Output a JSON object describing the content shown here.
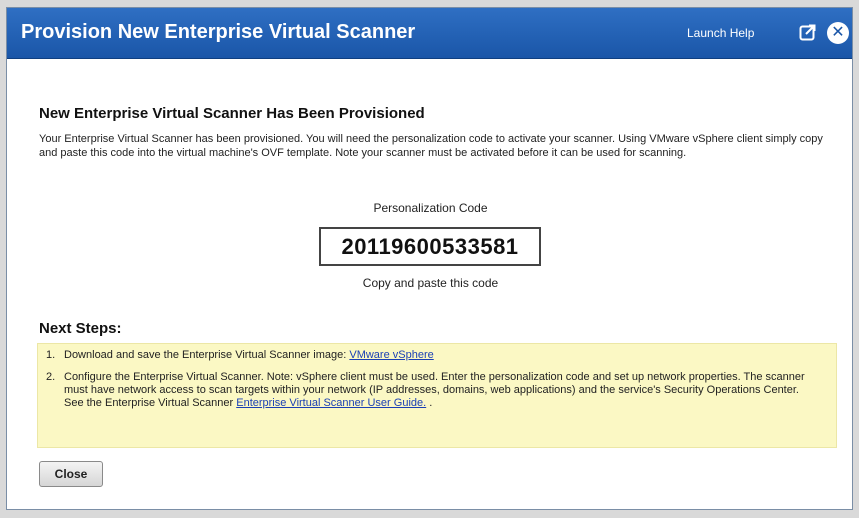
{
  "window": {
    "title": "Provision New Enterprise Virtual Scanner",
    "launch_help": "Launch Help",
    "close_glyph": "✕",
    "icons": {
      "popout": "popout-icon",
      "close": "close-icon"
    },
    "colors": {
      "titlebar": "#1f5db0",
      "steps_bg": "#fbf8c4",
      "link": "#1a3fb5"
    }
  },
  "main": {
    "heading": "New Enterprise Virtual Scanner Has Been Provisioned",
    "intro": "Your Enterprise Virtual Scanner has been provisioned. You will need the personalization code to activate your scanner. Using VMware vSphere client simply copy and paste this code into the virtual machine's OVF template. Note your scanner must be activated before it can be used for scanning.",
    "code_label": "Personalization Code",
    "code": "20119600533581",
    "code_hint": "Copy and paste this code"
  },
  "next_steps": {
    "title": "Next Steps:",
    "step1": {
      "num": "1.",
      "text": "Download and save the Enterprise Virtual Scanner image: ",
      "link": "VMware vSphere"
    },
    "step2": {
      "num": "2.",
      "text": "Configure the Enterprise Virtual Scanner. Note: vSphere client must be used. Enter the personalization code and set up network properties. The scanner must have network access to scan targets within your network (IP addresses, domains, web applications) and the service's Security Operations Center. See the Enterprise Virtual Scanner ",
      "link": "Enterprise Virtual Scanner User Guide.",
      "suffix": " ."
    }
  },
  "footer": {
    "close_label": "Close"
  }
}
